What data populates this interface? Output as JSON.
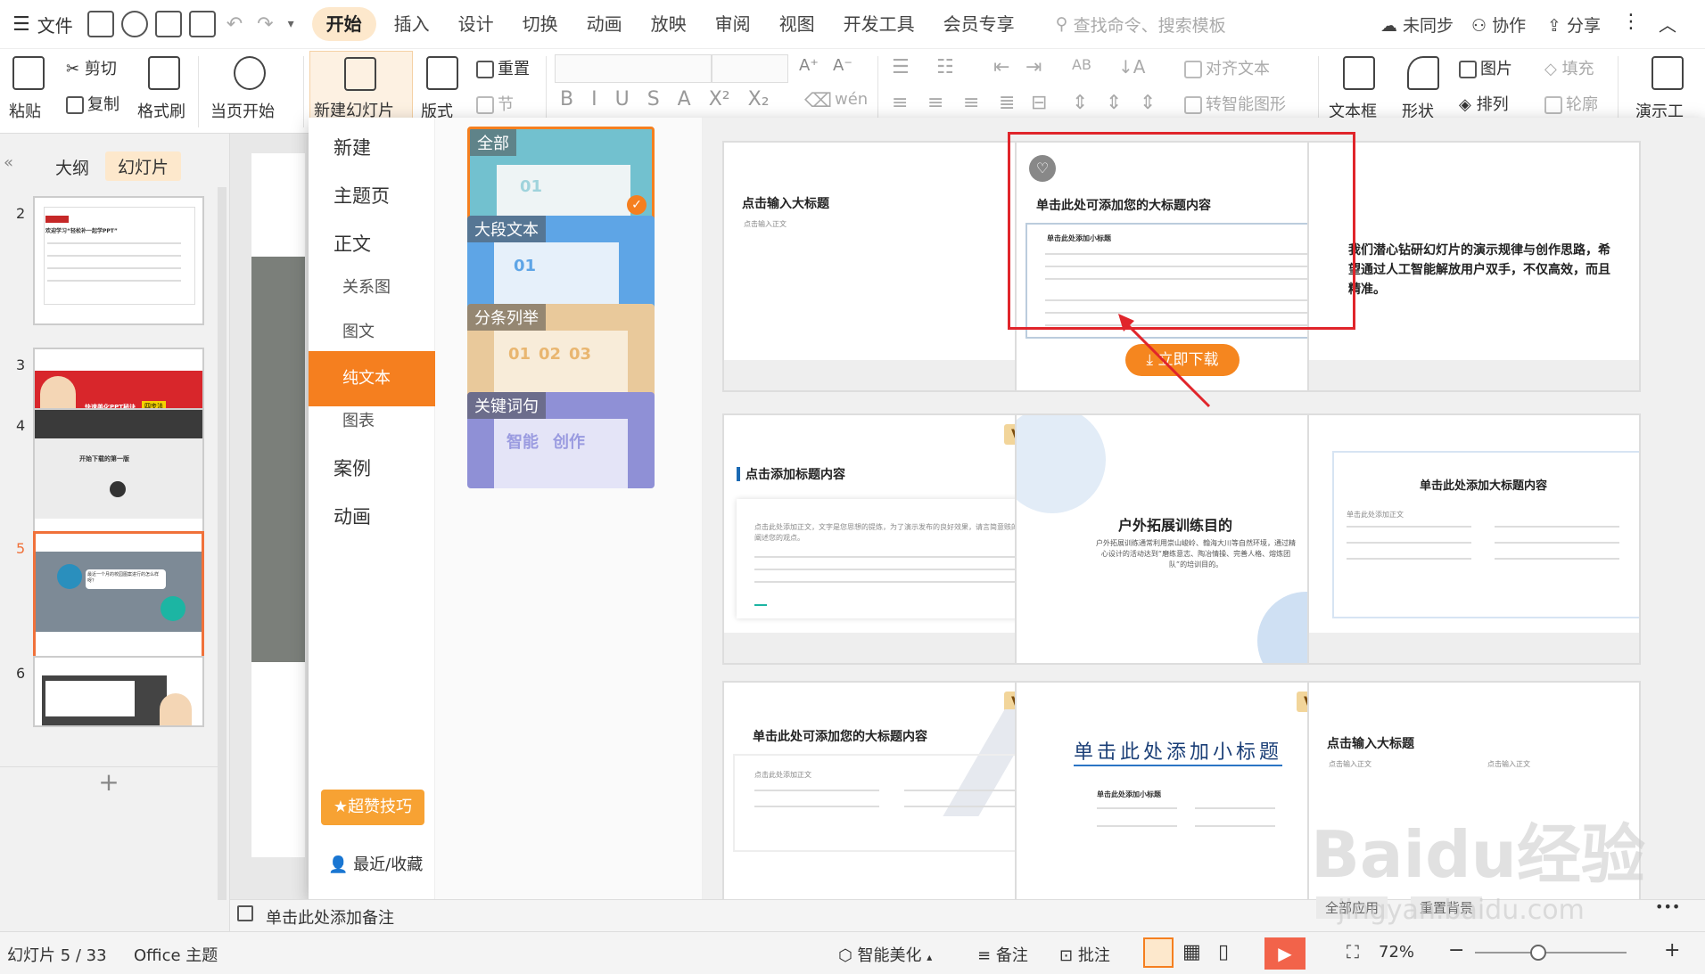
{
  "menubar": {
    "file": "文件",
    "tabs": [
      "开始",
      "插入",
      "设计",
      "切换",
      "动画",
      "放映",
      "审阅",
      "视图",
      "开发工具",
      "会员专享"
    ],
    "active_tab": "开始",
    "search_placeholder": "查找命令、搜索模板",
    "sync": "未同步",
    "collab": "协作",
    "share": "分享"
  },
  "ribbon": {
    "paste": "粘贴",
    "cut": "剪切",
    "copy": "复制",
    "format_painter": "格式刷",
    "from_current": "当页开始",
    "new_slide": "新建幻灯片",
    "layout": "版式",
    "reset": "重置",
    "section": "节",
    "align_text": "对齐文本",
    "smart_art": "转智能图形",
    "textbox": "文本框",
    "shape": "形状",
    "picture": "图片",
    "fill": "填充",
    "arrange": "排列",
    "outline": "轮廓",
    "present": "演示工",
    "font_chars": [
      "B",
      "I",
      "U",
      "S",
      "A",
      "X²",
      "X₂"
    ],
    "font_size_up": "A⁺",
    "font_size_down": "A⁻"
  },
  "left_panel": {
    "tabs": [
      "大纲",
      "幻灯片"
    ],
    "active_tab": "幻灯片",
    "slide_numbers": [
      "2",
      "3",
      "4",
      "5",
      "6"
    ],
    "selected": "5",
    "thumb_texts": {
      "s2_title": "欢迎学习“轻松补一起学PPT”",
      "s3_title": "快速美化PPT秘诀",
      "s3_badge": "四步法",
      "s4_title": "开始下载的第一版",
      "s5_title": "最近一个月的校园图案进行的怎么样呀？"
    },
    "add": "+"
  },
  "dropdown": {
    "nav": [
      {
        "label": "新建",
        "arrow": ""
      },
      {
        "label": "主题页",
        "arrow": "›"
      },
      {
        "label": "正文",
        "arrow": "⌄"
      },
      {
        "label": "关系图",
        "arrow": ""
      },
      {
        "label": "图文",
        "arrow": ""
      },
      {
        "label": "纯文本",
        "arrow": ""
      },
      {
        "label": "图表",
        "arrow": ""
      },
      {
        "label": "案例",
        "arrow": "›"
      },
      {
        "label": "动画",
        "arrow": "›"
      }
    ],
    "selected_nav": "纯文本",
    "tips_button": "超赞技巧",
    "recent": "最近/收藏",
    "categories": [
      {
        "label": "全部",
        "nums": [
          "01"
        ]
      },
      {
        "label": "大段文本",
        "nums": [
          "01"
        ]
      },
      {
        "label": "分条列举",
        "nums": [
          "01",
          "02",
          "03"
        ]
      },
      {
        "label": "关键词句",
        "nums": [
          "智能",
          "创作"
        ]
      }
    ],
    "selected_category": "全部",
    "cards": [
      {
        "title": "点击输入大标题",
        "sub": "点击输入正文",
        "vip": ""
      },
      {
        "title": "单击此处可添加您的大标题内容",
        "sub": "单击此处添加小标题",
        "vip": "",
        "download": "立即下载"
      },
      {
        "title": "我们潜心钻研幻灯片的演示规律与创作思路，希望通过人工智能解放用户双手，不仅高效，而且精准。",
        "sub": "",
        "vip": ""
      },
      {
        "title": "点击添加标题内容",
        "sub": "点击此处添加正文，文字是您思想的提炼，为了演示发布的良好效果，请言简意赅的阐述您的观点。",
        "vip": "VIP"
      },
      {
        "title": "户外拓展训练目的",
        "sub": "户外拓展训练通常利用崇山峻岭、翰海大川等自然环境，通过精心设计的活动达到“磨练意志、陶冶情操、完善人格、熔炼团队”的培训目的。",
        "vip": ""
      },
      {
        "title": "单击此处添加大标题内容",
        "sub": "单击此处添加正文",
        "vip": ""
      },
      {
        "title": "单击此处可添加您的大标题内容",
        "sub": "点击此处添加正文",
        "vip": "VIP"
      },
      {
        "title": "单击此处添加小标题",
        "sub": "单击此处添加小标题",
        "vip": "VIP"
      },
      {
        "title": "点击输入大标题",
        "sub": "点击输入正文",
        "vip": ""
      }
    ]
  },
  "notes": {
    "placeholder": "单击此处添加备注",
    "apply_all": "全部应用",
    "reset_bg": "重置背景"
  },
  "status": {
    "slide_info": "幻灯片 5 / 33",
    "theme": "Office 主题",
    "beautify": "智能美化",
    "notes": "备注",
    "comment": "批注",
    "zoom": "72%",
    "zoom_level": 0.42
  },
  "watermark": {
    "logo": "Baidu经验",
    "url": "jingyan.baidu.com"
  },
  "colors": {
    "accent": "#f57f1f",
    "selected_thumb": "#f0713a",
    "active_tab_bg": "#fde8cc",
    "play": "#f2634a"
  }
}
